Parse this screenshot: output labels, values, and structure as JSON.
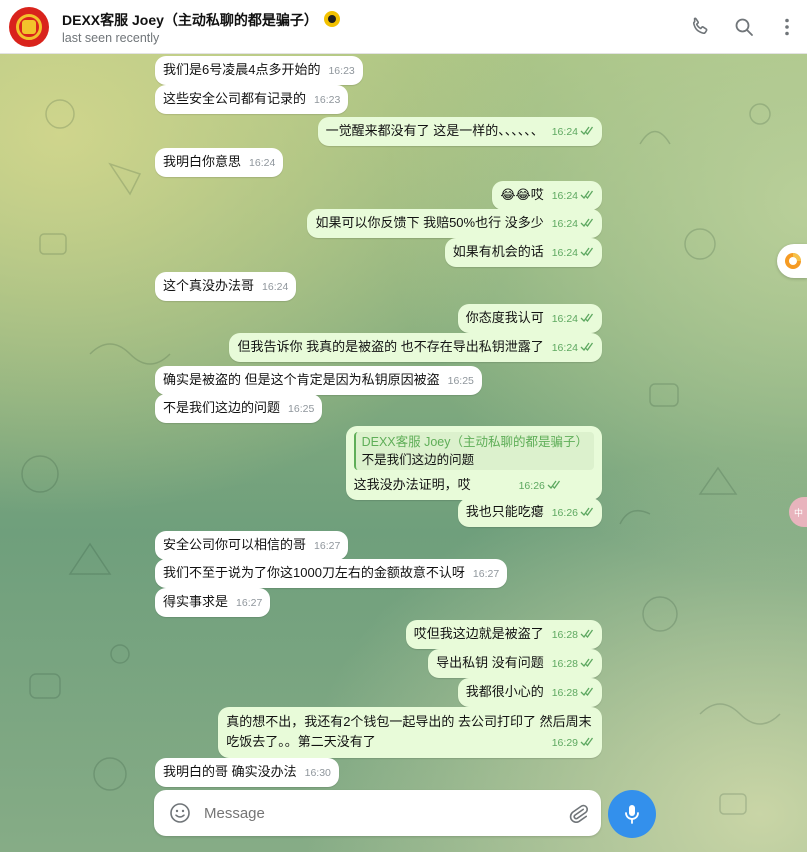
{
  "header": {
    "title": "DEXX客服 Joey（主动私聊的都是骗子）",
    "subtitle": "last seen recently",
    "badge_icon": "coin-badge-icon",
    "icons": [
      "phone-icon",
      "search-icon",
      "more-vertical-icon"
    ]
  },
  "messages": [
    {
      "dir": "in",
      "text": "我们是6号凌晨4点多开始的",
      "time": "16:23"
    },
    {
      "dir": "in",
      "text": "这些安全公司都有记录的",
      "time": "16:23"
    },
    {
      "dir": "out",
      "text": "一觉醒来都没有了 这是一样的、、、、、、",
      "time": "16:24"
    },
    {
      "dir": "in",
      "text": "我明白你意思",
      "time": "16:24"
    },
    {
      "dir": "out",
      "text": "😂😂哎",
      "time": "16:24"
    },
    {
      "dir": "out",
      "text": "如果可以你反馈下 我赔50%也行 没多少",
      "time": "16:24"
    },
    {
      "dir": "out",
      "text": "如果有机会的话",
      "time": "16:24"
    },
    {
      "dir": "in",
      "text": "这个真没办法哥",
      "time": "16:24"
    },
    {
      "dir": "out",
      "text": "你态度我认可",
      "time": "16:24"
    },
    {
      "dir": "out",
      "text": "但我告诉你 我真的是被盗的 也不存在导出私钥泄露了",
      "time": "16:24"
    },
    {
      "dir": "in",
      "text": "确实是被盗的 但是这个肯定是因为私钥原因被盗",
      "time": "16:25"
    },
    {
      "dir": "in",
      "text": "不是我们这边的问题",
      "time": "16:25"
    },
    {
      "dir": "out",
      "text": "这我没办法证明，哎",
      "time": "16:26",
      "reply": {
        "name": "DEXX客服 Joey（主动私聊的都是骗子）",
        "text": "不是我们这边的问题"
      }
    },
    {
      "dir": "out",
      "text": "我也只能吃瘪",
      "time": "16:26"
    },
    {
      "dir": "in",
      "text": "安全公司你可以相信的哥",
      "time": "16:27"
    },
    {
      "dir": "in",
      "text": "我们不至于说为了你这1000刀左右的金额故意不认呀",
      "time": "16:27"
    },
    {
      "dir": "in",
      "text": "得实事求是",
      "time": "16:27"
    },
    {
      "dir": "out",
      "text": "哎但我这边就是被盗了",
      "time": "16:28"
    },
    {
      "dir": "out",
      "text": "导出私钥 没有问题",
      "time": "16:28"
    },
    {
      "dir": "out",
      "text": "我都很小心的",
      "time": "16:28"
    },
    {
      "dir": "out",
      "text": "真的想不出，我还有2个钱包一起导出的 去公司打印了 然后周末",
      "text2": "吃饭去了。。第二天没有了",
      "time": "16:29"
    },
    {
      "dir": "in",
      "text": "我明白的哥 确实没办法",
      "time": "16:30"
    }
  ],
  "composer": {
    "placeholder": "Message",
    "icons": [
      "emoji-icon",
      "attach-icon",
      "mic-icon"
    ]
  },
  "side": {
    "pill_text": "中"
  },
  "colors": {
    "incoming_bubble": "#ffffff",
    "outgoing_bubble": "#e8fbd9",
    "accent": "#3390ec",
    "read_ticks": "#5da860"
  }
}
